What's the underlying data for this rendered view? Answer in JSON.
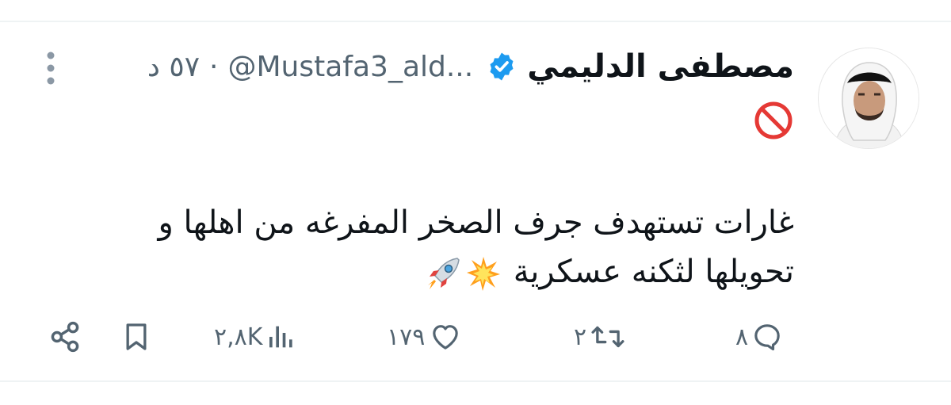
{
  "tweet": {
    "author": {
      "display_name": "مصطفى الدليمي",
      "handle": "@Mustafa3_ald...",
      "verified": true,
      "avatar": "avatar-man-in-headscarf"
    },
    "time_ago": "٥٧ د",
    "separator": "·",
    "status_emoji": "🚫",
    "text_lines": [
      "غارات تستهدف جرف الصخر المفرغه من اهلها و",
      "تحويلها لثكنه عسكرية"
    ],
    "text_emojis": [
      "💥",
      "🚀"
    ],
    "actions": {
      "replies": {
        "count": "٨",
        "icon": "reply-icon"
      },
      "reposts": {
        "count": "٢",
        "icon": "repost-icon"
      },
      "likes": {
        "count": "١٧٩",
        "icon": "heart-icon"
      },
      "views": {
        "count": "٢,٨K",
        "icon": "views-icon"
      },
      "bookmark": {
        "icon": "bookmark-icon"
      },
      "share": {
        "icon": "share-icon"
      }
    },
    "colors": {
      "text": "#0f1419",
      "secondary": "#536471",
      "verified": "#1d9bf0",
      "divider": "#eff3f4"
    }
  }
}
